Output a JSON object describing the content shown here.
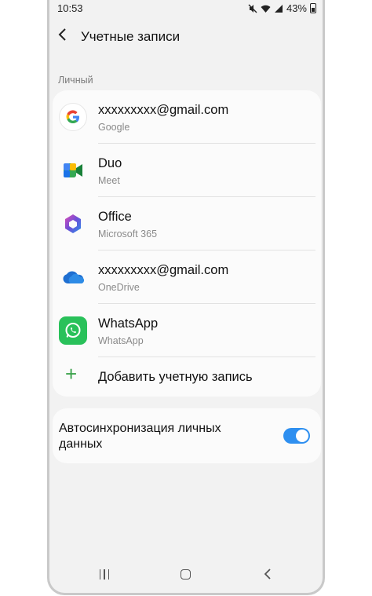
{
  "status_bar": {
    "time": "10:53",
    "battery": "43%",
    "icons": [
      "mute-icon",
      "wifi-icon",
      "signal-icon",
      "battery-icon"
    ]
  },
  "header": {
    "back_glyph": "<",
    "title": "Учетные записи"
  },
  "section": {
    "label": "Личный"
  },
  "accounts": [
    {
      "name": "xxxxxxxxx@gmail.com",
      "sub": "Google",
      "icon": "google-icon"
    },
    {
      "name": "Duo",
      "sub": "Meet",
      "icon": "duo-meet-icon"
    },
    {
      "name": "Office",
      "sub": "Microsoft 365",
      "icon": "office-icon"
    },
    {
      "name": "xxxxxxxxx@gmail.com",
      "sub": "OneDrive",
      "icon": "onedrive-icon"
    },
    {
      "name": "WhatsApp",
      "sub": "WhatsApp",
      "icon": "whatsapp-icon"
    }
  ],
  "add_account": {
    "glyph": "+",
    "label": "Добавить учетную запись"
  },
  "sync": {
    "label": "Автосинхронизация личных данных",
    "enabled": true
  },
  "colors": {
    "toggle_on": "#2e8ff0",
    "add_plus": "#3aa14a",
    "background": "#f2f2f2"
  }
}
